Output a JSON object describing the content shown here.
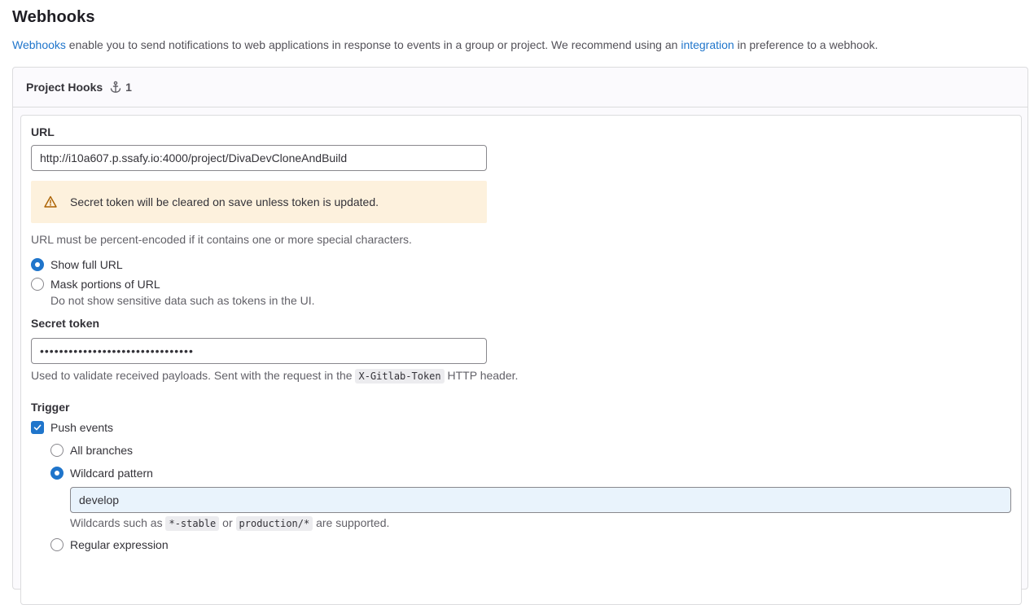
{
  "page": {
    "title": "Webhooks",
    "intro_link1": "Webhooks",
    "intro_mid": " enable you to send notifications to web applications in response to events in a group or project. We recommend using an ",
    "intro_link2": "integration",
    "intro_end": " in preference to a webhook."
  },
  "card": {
    "title": "Project Hooks",
    "hook_count": "1",
    "hook_icon": "anchor-icon"
  },
  "form": {
    "url_label": "URL",
    "url_value": "http://i10a607.p.ssafy.io:4000/project/DivaDevCloneAndBuild",
    "alert_text": "Secret token will be cleared on save unless token is updated.",
    "url_help": "URL must be percent-encoded if it contains one or more special characters.",
    "show_full_url": "Show full URL",
    "mask_url": "Mask portions of URL",
    "mask_help": "Do not show sensitive data such as tokens in the UI.",
    "url_display_selected": "Show full URL",
    "secret_label": "Secret token",
    "secret_value": "••••••••••••••••••••••••••••••••",
    "secret_help_before": "Used to validate received payloads. Sent with the request in the ",
    "secret_help_code": "X-Gitlab-Token",
    "secret_help_after": " HTTP header.",
    "trigger_label": "Trigger",
    "push_events": "Push events",
    "push_events_checked": true,
    "all_branches": "All branches",
    "wildcard": "Wildcard pattern",
    "branch_filter_selected": "Wildcard pattern",
    "wildcard_value": "develop",
    "wildcard_help_before": "Wildcards such as ",
    "wildcard_code1": "*-stable",
    "wildcard_help_mid": " or ",
    "wildcard_code2": "production/*",
    "wildcard_help_after": " are supported.",
    "regex": "Regular expression"
  },
  "colors": {
    "link": "#1f75cb",
    "accent": "#1f75cb",
    "warning_bg": "#fdf1dd",
    "warning_icon": "#ab6100"
  }
}
